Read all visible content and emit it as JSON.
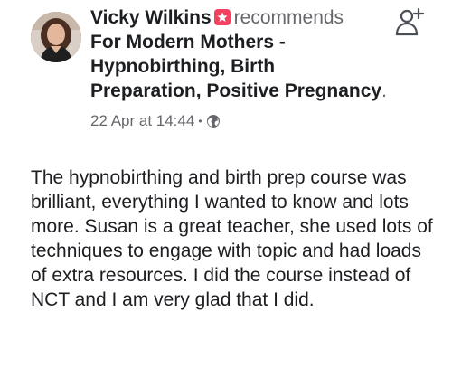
{
  "post": {
    "author": "Vicky Wilkins",
    "verb": "recommends",
    "page_name": "For Modern Mothers - Hypnobirthing, Birth Preparation,  Positive Pregnancy",
    "page_name_tail": ".",
    "timestamp": "22 Apr at 14:44",
    "separator": "•",
    "body": "The hypnobirthing and birth prep course was brilliant, everything I wanted to know and lots more. Susan is a great teacher, she used lots of techniques to engage with topic and had loads of extra resources. I did the course instead of NCT and I am very glad that I did."
  },
  "icons": {
    "recommend": "recommend-icon",
    "privacy": "globe-icon",
    "add_friend": "add-friend-icon"
  },
  "colors": {
    "recommend_accent": "#f3425f",
    "secondary_text": "#65676b",
    "primary_text": "#1c1e21"
  }
}
